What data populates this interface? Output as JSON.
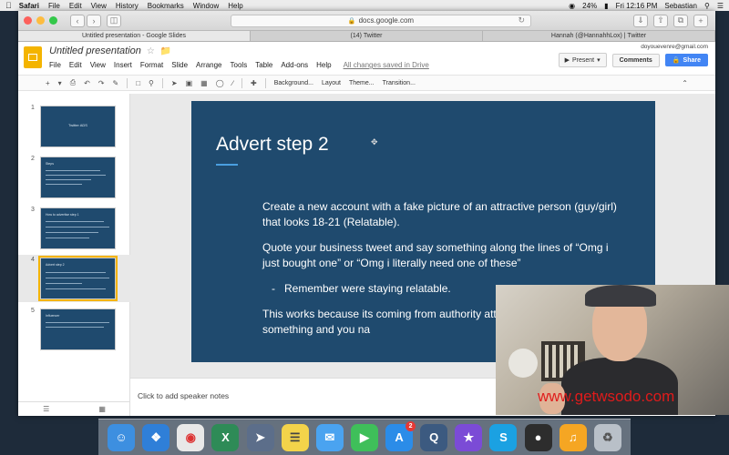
{
  "menubar": {
    "apple": "",
    "items": [
      "Safari",
      "File",
      "Edit",
      "View",
      "History",
      "Bookmarks",
      "Window",
      "Help"
    ],
    "battery": "24%",
    "clock": "Fri 12:16 PM",
    "user": "Sebastian"
  },
  "browser": {
    "url": "docs.google.com",
    "tabs": [
      "Untitled presentation - Google Slides",
      "(14) Twitter",
      "Hannah (@HannahhLox) | Twitter"
    ]
  },
  "app": {
    "doc_title": "Untitled presentation",
    "menus": [
      "File",
      "Edit",
      "View",
      "Insert",
      "Format",
      "Slide",
      "Arrange",
      "Tools",
      "Table",
      "Add-ons",
      "Help"
    ],
    "saved_status": "All changes saved in Drive",
    "account_email": "doyouevenre@gmail.com",
    "present_label": "Present",
    "comments_label": "Comments",
    "share_label": "Share",
    "toolbar": {
      "background": "Background...",
      "layout": "Layout",
      "theme": "Theme...",
      "transition": "Transition..."
    }
  },
  "filmstrip": {
    "slides": [
      {
        "num": "1",
        "title": "Twitter ADS"
      },
      {
        "num": "2",
        "title": "Steps"
      },
      {
        "num": "3",
        "title": "How to advertise step 1"
      },
      {
        "num": "4",
        "title": "Advert step 2"
      },
      {
        "num": "5",
        "title": "Influencer"
      }
    ],
    "selected": 4
  },
  "slide": {
    "title": "Advert step 2",
    "paragraph1": "Create a new account with a fake picture of an attractive person (guy/girl) that looks 18-21 (Relatable).",
    "paragraph2": "Quote your business tweet and say something along the lines of “Omg i just bought one” or “Omg i literally need one of these”",
    "bullet_dash": "-",
    "bullet": "Remember were staying relatable.",
    "paragraph3": "This works because its coming from authority attractive tell you to do something and you na"
  },
  "notes_placeholder": "Click to add speaker notes",
  "webcam": {
    "watermark": "www.getwsodo.com"
  },
  "dock": {
    "apps": [
      {
        "name": "finder",
        "color": "#3d8fe0"
      },
      {
        "name": "safari",
        "color": "#2f7fd8"
      },
      {
        "name": "chrome",
        "color": "#e8e8e8"
      },
      {
        "name": "excel",
        "color": "#2e8b57"
      },
      {
        "name": "launchpad",
        "color": "#5c6e8a"
      },
      {
        "name": "notes",
        "color": "#f3d34a"
      },
      {
        "name": "messages",
        "color": "#4aa3f0"
      },
      {
        "name": "facetime",
        "color": "#3fbf5a"
      },
      {
        "name": "app-store",
        "color": "#2b8ce8",
        "badge": "2"
      },
      {
        "name": "quicktime",
        "color": "#3c5a80"
      },
      {
        "name": "imovie",
        "color": "#7b4bd6"
      },
      {
        "name": "skype",
        "color": "#1ba1e2"
      },
      {
        "name": "obs",
        "color": "#2d2d2d"
      },
      {
        "name": "audio",
        "color": "#f5a623"
      },
      {
        "name": "trash",
        "color": "#b9c0c8"
      }
    ]
  }
}
